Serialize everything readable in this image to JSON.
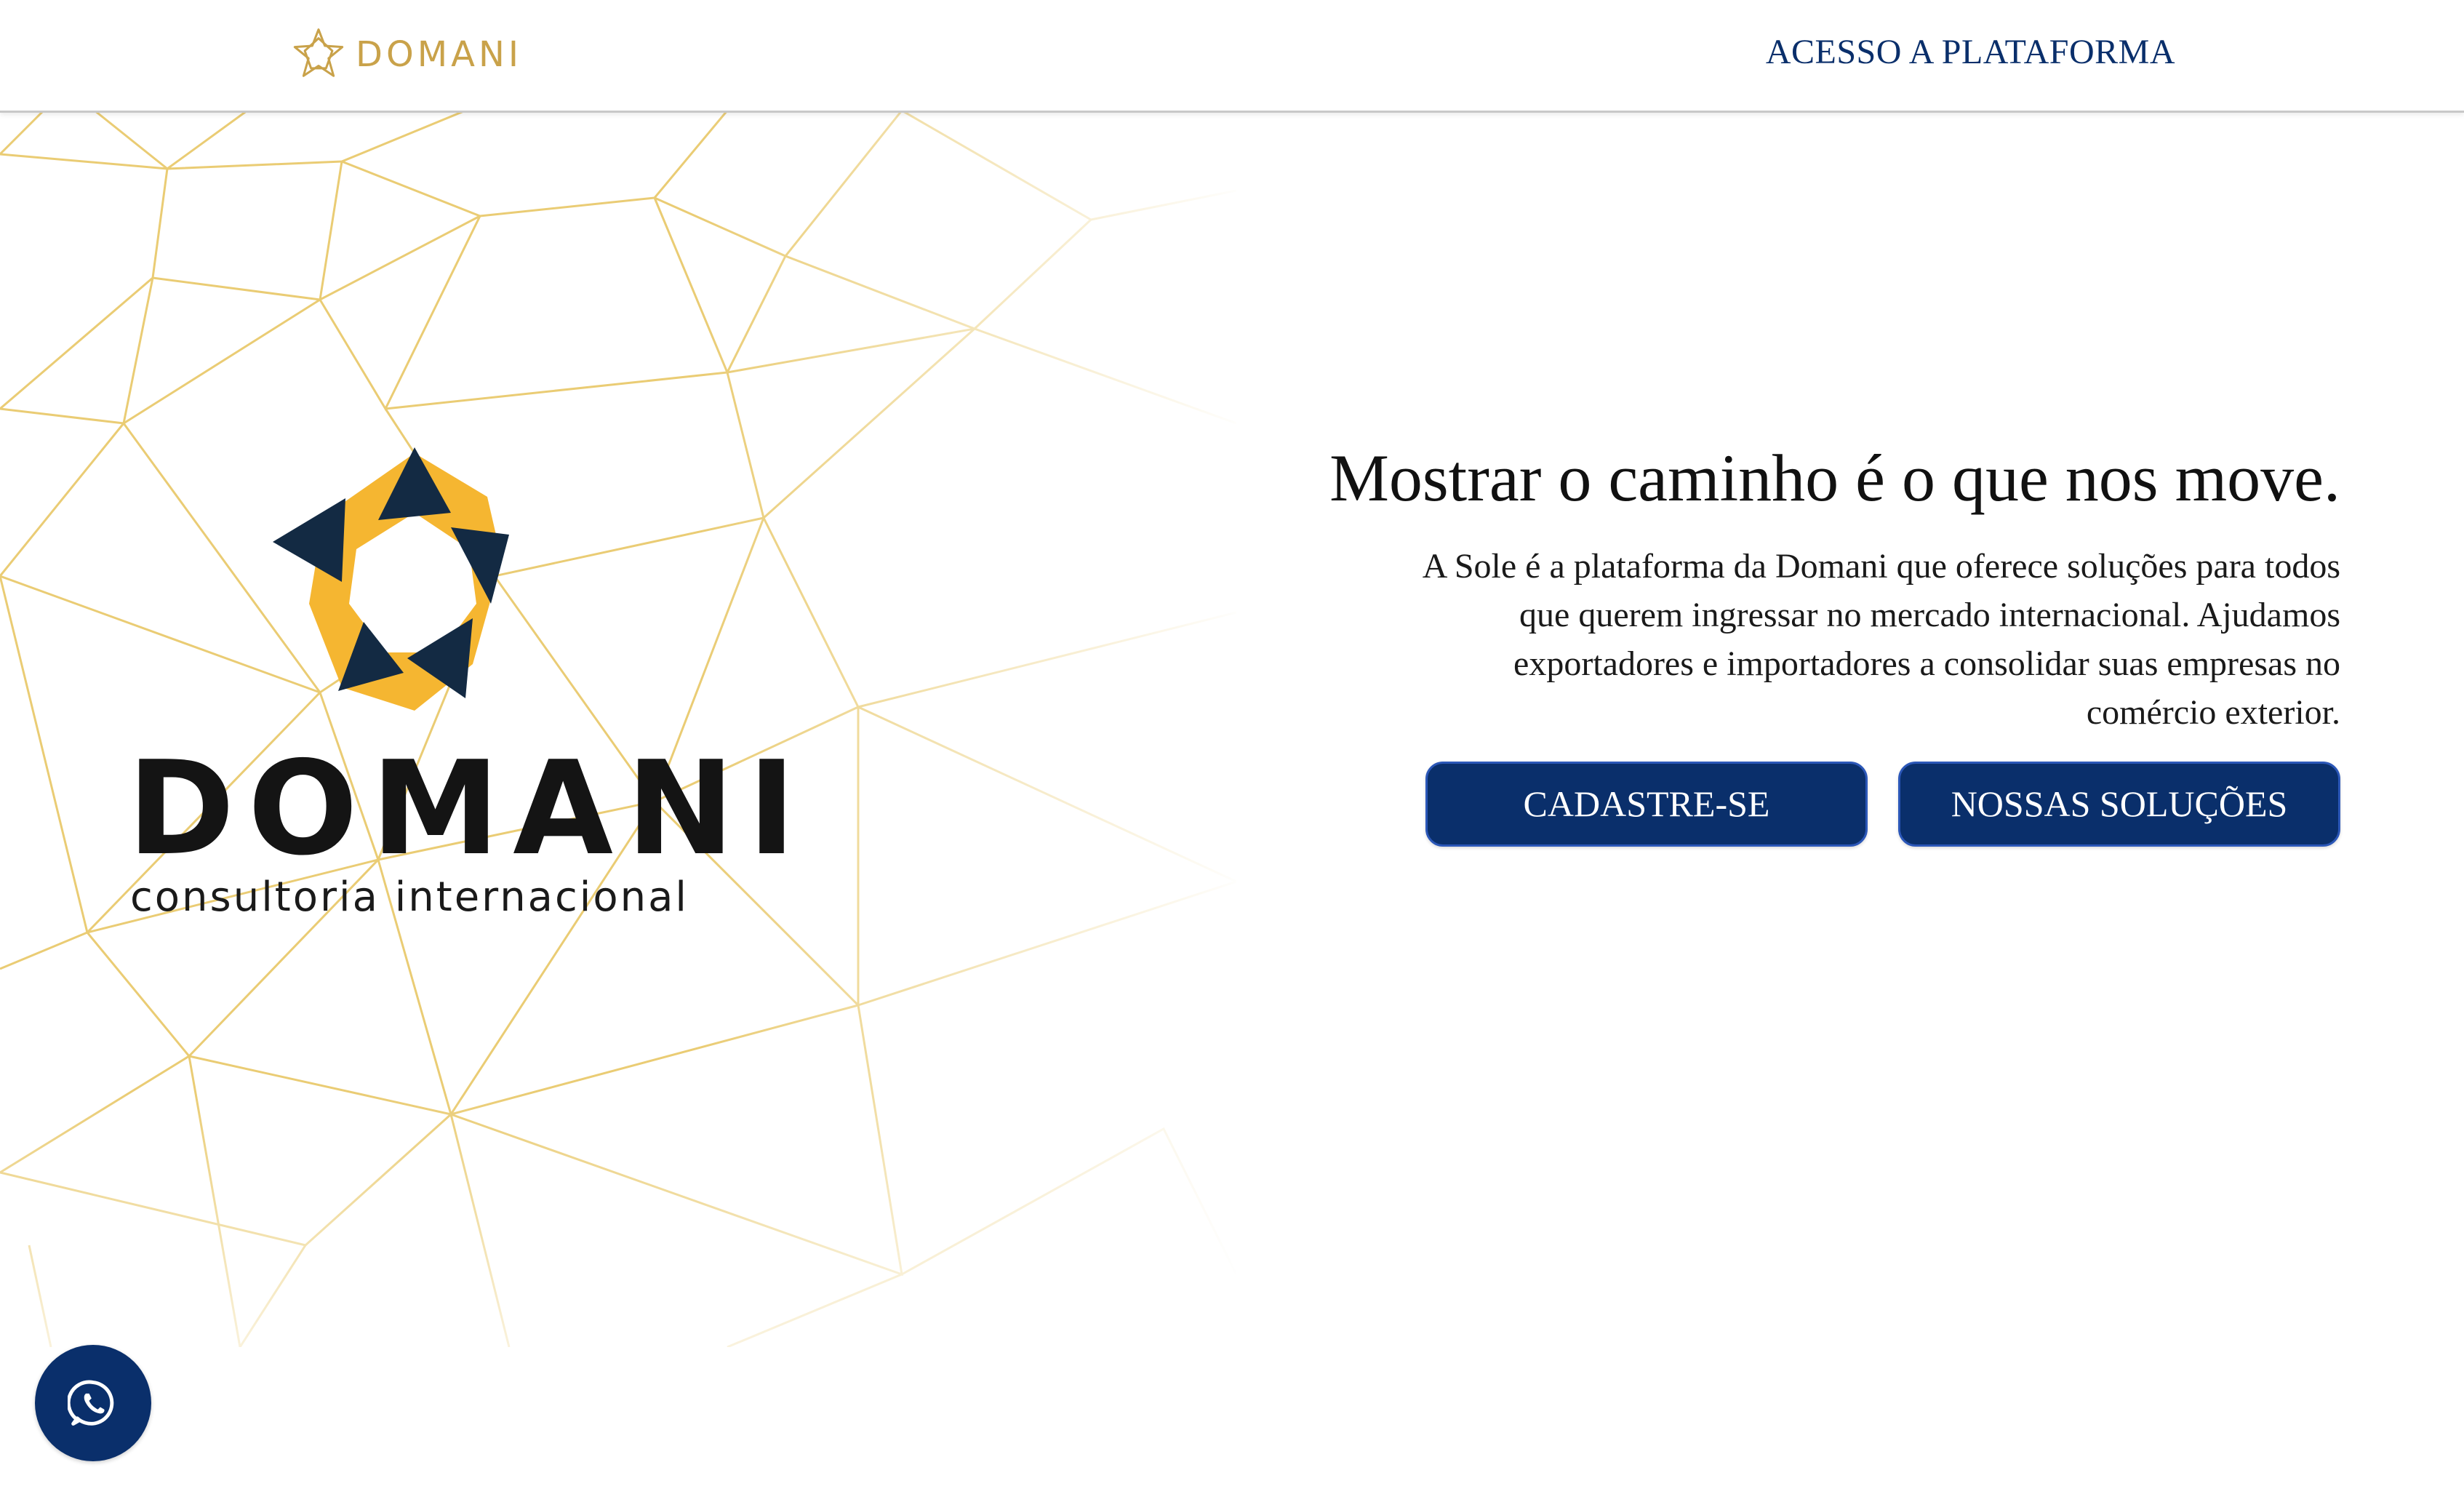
{
  "header": {
    "brand_name": "DOMANI",
    "nav_link": "ACESSO A PLATAFORMA"
  },
  "logo": {
    "wordmark": "DOMANI",
    "tagline": "consultoria internacional"
  },
  "hero": {
    "title": "Mostrar o caminho é o que nos move.",
    "description": "A Sole é a plataforma da Domani que oferece soluções para todos que querem ingressar no mercado internacional. Ajudamos exportadores e importadores a consolidar suas empresas no comércio exterior.",
    "buttons": [
      {
        "label": "CADASTRE-SE"
      },
      {
        "label": "NOSSAS SOLUÇÕES"
      }
    ]
  },
  "whatsapp": {
    "icon": "whatsapp-icon"
  },
  "colors": {
    "primary_navy": "#0a2f6b",
    "brand_gold": "#c9a24a",
    "logo_yellow": "#f5b631",
    "logo_dark": "#132a43",
    "pattern_gold": "#e8c766"
  }
}
